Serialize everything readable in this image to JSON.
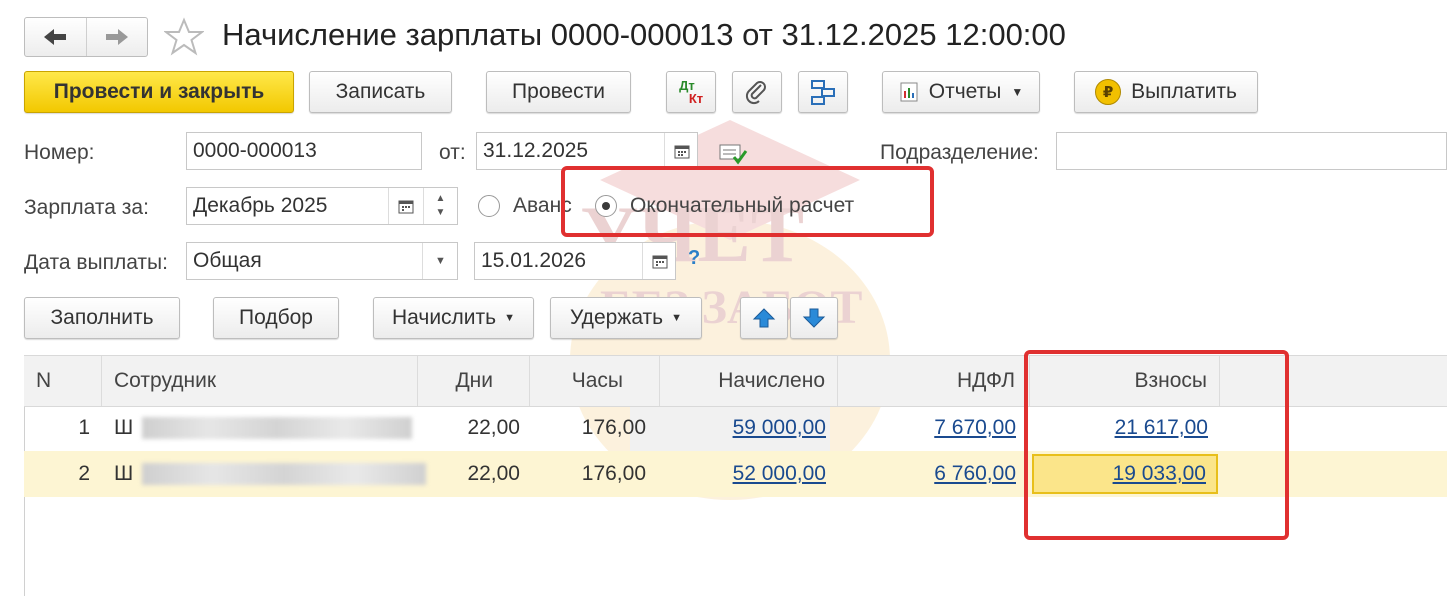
{
  "title": "Начисление зарплаты 0000-000013 от 31.12.2025 12:00:00",
  "nav": {
    "back_icon": "arrow-left-icon",
    "forward_icon": "arrow-right-icon",
    "favorite_icon": "star-icon"
  },
  "toolbar": {
    "post_close": "Провести и закрыть",
    "save": "Записать",
    "post": "Провести",
    "dtkt_dt": "Дт",
    "dtkt_kt": "Кт",
    "reports": "Отчеты",
    "pay": "Выплатить",
    "pay_icon_glyph": "₽"
  },
  "form": {
    "number_label": "Номер:",
    "number_value": "0000-000013",
    "from_label": "от:",
    "date_value": "31.12.2025",
    "division_label": "Подразделение:",
    "division_value": "",
    "salary_for_label": "Зарплата за:",
    "salary_for_value": "Декабрь 2025",
    "advance_label": "Аванс",
    "final_label": "Окончательный расчет",
    "pay_date_label": "Дата выплаты:",
    "pay_date_kind": "Общая",
    "pay_date_value": "15.01.2026",
    "help_glyph": "?"
  },
  "table_toolbar": {
    "fill": "Заполнить",
    "select": "Подбор",
    "accrue": "Начислить",
    "withhold": "Удержать"
  },
  "table": {
    "columns": [
      "N",
      "Сотрудник",
      "Дни",
      "Часы",
      "Начислено",
      "НДФЛ",
      "Взносы"
    ],
    "rows": [
      {
        "n": "1",
        "employee": "Ш",
        "days": "22,00",
        "hours": "176,00",
        "accrued": "59 000,00",
        "ndfl": "7 670,00",
        "contrib": "21 617,00"
      },
      {
        "n": "2",
        "employee": "Ш",
        "days": "22,00",
        "hours": "176,00",
        "accrued": "52 000,00",
        "ndfl": "6 760,00",
        "contrib": "19 033,00"
      }
    ]
  },
  "watermark": {
    "line1": "УЧЕТ",
    "line2": "БЕЗ ЗАБОТ"
  },
  "colors": {
    "primary_button": "#f2c800",
    "link": "#1a4a8f",
    "selected_row": "#fdf5d3",
    "highlight_box": "#e03030"
  }
}
